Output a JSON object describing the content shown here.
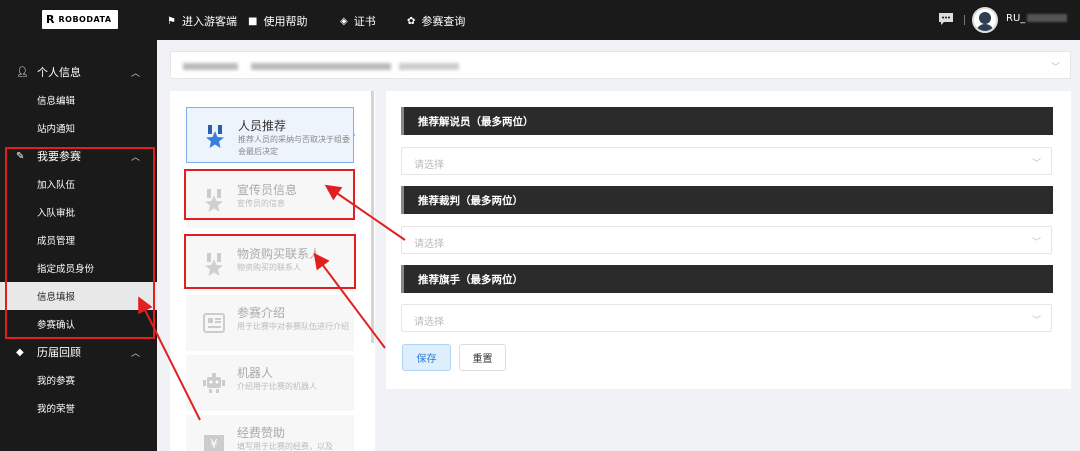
{
  "header": {
    "logo_mark": "R",
    "logo_text": "ROBODATA",
    "nav": [
      {
        "label": "进入游客端",
        "icon": "flag-icon"
      },
      {
        "label": "使用帮助",
        "icon": "help-book-icon"
      },
      {
        "label": "证书",
        "icon": "diamond-icon"
      },
      {
        "label": "参赛查询",
        "icon": "gear-flower-icon"
      }
    ],
    "username": "RU_"
  },
  "sidebar": {
    "groups": [
      {
        "label": "个人信息",
        "icon": "user-icon",
        "items": [
          "信息编辑",
          "站内通知"
        ]
      },
      {
        "label": "我要参赛",
        "icon": "edit-icon",
        "items": [
          "加入队伍",
          "入队审批",
          "成员管理",
          "指定成员身份",
          "信息填报",
          "参赛确认"
        ]
      },
      {
        "label": "历届回顾",
        "icon": "cube-icon",
        "items": [
          "我的参赛",
          "我的荣誉"
        ]
      }
    ],
    "active_item": "信息填报"
  },
  "cards": [
    {
      "title": "人员推荐",
      "desc": "推荐人员的采纳与否取决于组委会最后决定",
      "icon": "medal-icon"
    },
    {
      "title": "宣传员信息",
      "desc": "宣传员的信息",
      "icon": "medal-icon"
    },
    {
      "title": "物资购买联系人",
      "desc": "物资购买的联系人",
      "icon": "medal-icon"
    },
    {
      "title": "参赛介绍",
      "desc": "用于比赛中对参赛队伍进行介绍",
      "icon": "newspaper-icon"
    },
    {
      "title": "机器人",
      "desc": "介绍用于比赛的机器人",
      "icon": "robot-icon"
    },
    {
      "title": "经费赞助",
      "desc": "填写用于比赛的经费，以及",
      "icon": "yen-icon"
    }
  ],
  "form": {
    "sections": [
      {
        "title": "推荐解说员（最多两位）",
        "placeholder": "请选择"
      },
      {
        "title": "推荐裁判（最多两位）",
        "placeholder": "请选择"
      },
      {
        "title": "推荐旗手（最多两位）",
        "placeholder": "请选择"
      }
    ],
    "save_label": "保存",
    "reset_label": "重置"
  },
  "colors": {
    "accent": "#2a7ad6",
    "highlight_red": "#e02020",
    "dark": "#1a1a1a"
  }
}
